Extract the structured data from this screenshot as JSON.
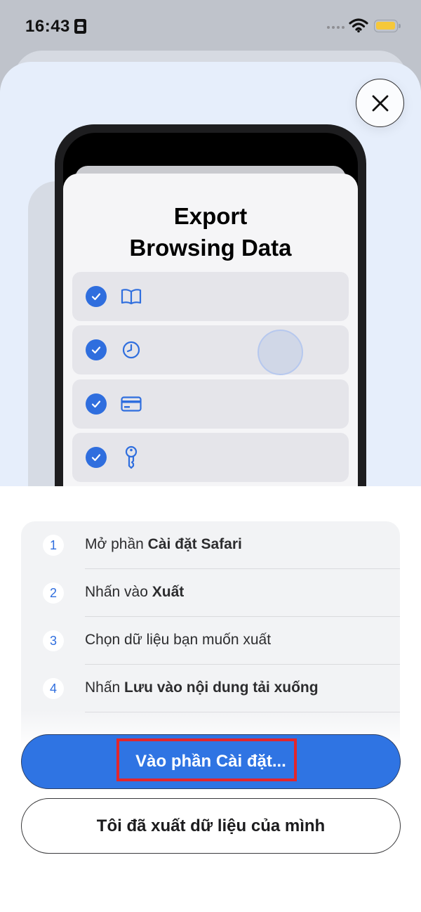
{
  "status_bar": {
    "time": "16:43",
    "battery_color": "#f6c83a"
  },
  "close_button": {
    "icon": "close-icon"
  },
  "export_preview": {
    "title_line1": "Export",
    "title_line2": "Browsing Data",
    "rows": [
      {
        "icon": "bookmarks-icon",
        "checked": true
      },
      {
        "icon": "history-clock-icon",
        "checked": true
      },
      {
        "icon": "credit-card-icon",
        "checked": true
      },
      {
        "icon": "key-icon",
        "checked": true
      }
    ]
  },
  "steps": [
    {
      "number": "1",
      "text_plain": "Mở phần ",
      "text_bold": "Cài đặt Safari"
    },
    {
      "number": "2",
      "text_plain": "Nhấn vào ",
      "text_bold": "Xuất"
    },
    {
      "number": "3",
      "text_plain": "Chọn dữ liệu bạn muốn xuất",
      "text_bold": ""
    },
    {
      "number": "4",
      "text_plain": "Nhấn ",
      "text_bold": "Lưu vào nội dung tải xuống"
    }
  ],
  "buttons": {
    "primary_label": "Vào phần Cài đặt...",
    "secondary_label": "Tôi đã xuất dữ liệu của mình"
  },
  "colors": {
    "accent": "#2f74e3",
    "highlight": "#e2262c",
    "sheet_background": "#e6eefb"
  }
}
